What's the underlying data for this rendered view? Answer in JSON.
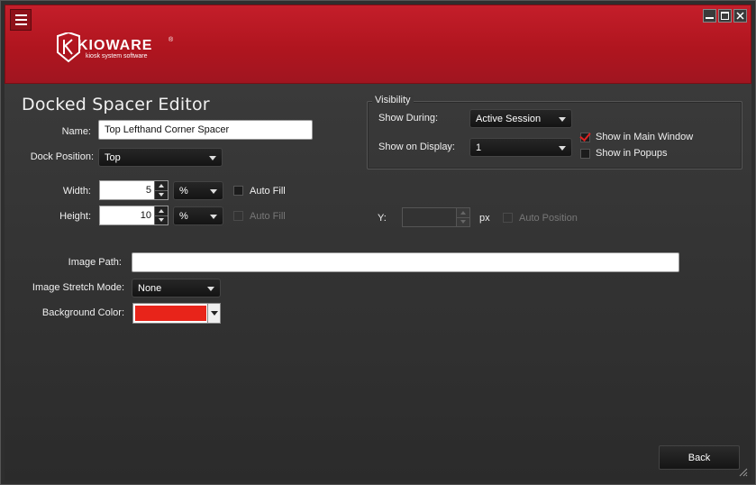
{
  "header": {
    "logo_text": "KIOWARE",
    "logo_tagline": "kiosk system software",
    "logo_registered": "®"
  },
  "editor": {
    "title": "Docked Spacer Editor",
    "name_label": "Name:",
    "name_value": "Top Lefthand Corner Spacer",
    "dock_position_label": "Dock Position:",
    "dock_position_value": "Top",
    "width_label": "Width:",
    "width_value": "5",
    "width_unit": "%",
    "width_auto_fill_label": "Auto Fill",
    "height_label": "Height:",
    "height_value": "10",
    "height_unit": "%",
    "height_auto_fill_label": "Auto Fill",
    "y_label": "Y:",
    "y_value": "",
    "y_unit": "px",
    "auto_position_label": "Auto Position",
    "image_path_label": "Image Path:",
    "image_path_value": "",
    "image_stretch_label": "Image Stretch Mode:",
    "image_stretch_value": "None",
    "background_color_label": "Background Color:",
    "background_color_value": "#e8241a"
  },
  "visibility": {
    "legend": "Visibility",
    "show_during_label": "Show During:",
    "show_during_value": "Active Session",
    "show_on_display_label": "Show on Display:",
    "show_on_display_value": "1",
    "show_main_window_label": "Show in Main Window",
    "show_main_window_checked": true,
    "show_popups_label": "Show in Popups",
    "show_popups_checked": false
  },
  "footer": {
    "back_label": "Back"
  },
  "colors": {
    "header_red": "#c41e2a",
    "panel_dark": "#2e2e2e",
    "check_red": "#dd2222"
  }
}
